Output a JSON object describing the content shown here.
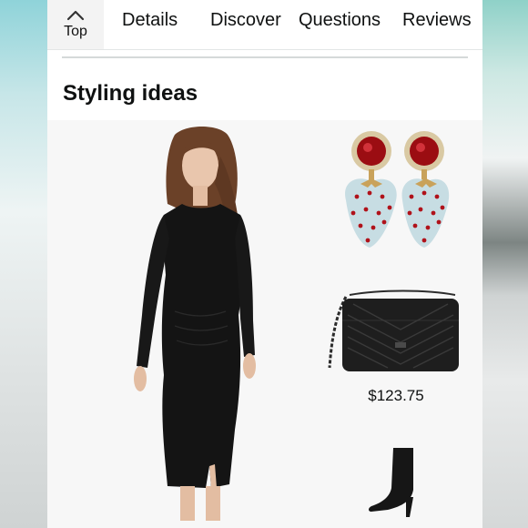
{
  "nav": {
    "top_label": "Top",
    "top_icon": "chevron-up-icon",
    "tabs": [
      {
        "label": "Details"
      },
      {
        "label": "Discover"
      },
      {
        "label": "Questions"
      },
      {
        "label": "Reviews"
      }
    ]
  },
  "section": {
    "title": "Styling ideas"
  },
  "products": {
    "bag_price": "$123.75"
  },
  "colors": {
    "panel_bg": "#f7f7f7",
    "dress": "#141414",
    "earring_gem": "#9b0d12",
    "earring_body": "#c7dde3"
  }
}
